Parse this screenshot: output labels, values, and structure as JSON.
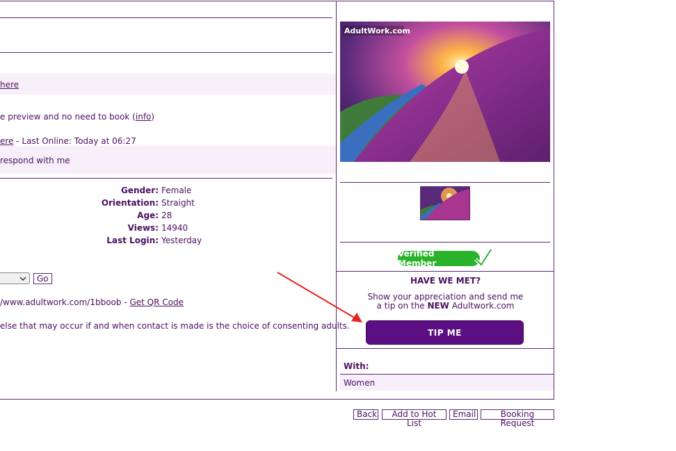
{
  "left": {
    "row_here": "here",
    "preview_text": "e preview and no need to book (",
    "info_link": "info",
    "preview_close": ")",
    "here_link2": "ere",
    "last_online": " - Last Online: Today at 06:27",
    "respond_text": "respond with me",
    "profile": [
      {
        "label": "Gender:",
        "value": "Female"
      },
      {
        "label": "Orientation:",
        "value": "Straight"
      },
      {
        "label": "Age:",
        "value": "28"
      },
      {
        "label": "Views:",
        "value": "14940"
      },
      {
        "label": "Last Login:",
        "value": "Yesterday"
      }
    ],
    "go_label": "Go",
    "url_text": "/www.adultwork.com/1bboob - ",
    "qr_link": "Get QR Code",
    "disclaimer": " else that may occur if and when contact is made is the choice of consenting adults."
  },
  "right": {
    "watermark": "AdultWork.com",
    "verified_label": "Verified Member",
    "have_we_met": "HAVE WE MET?",
    "tip_line1": "Show your appreciation and send me",
    "tip_line2_pre": "a tip on the ",
    "tip_line2_bold": "NEW",
    "tip_line2_post": " Adultwork.com",
    "tip_button": "TIP ME",
    "with_label": "With:",
    "with_value": "Women"
  },
  "bottom_buttons": {
    "back": "Back",
    "hotlist": "Add to Hot List",
    "email": "Email",
    "booking": "Booking Request"
  },
  "colors": {
    "text": "#4b1060",
    "band": "#f7effa",
    "tip_button": "#5c0f82",
    "verified": "#2ab22a",
    "arrow": "#e8231f"
  },
  "icons": [
    "checkmark-icon",
    "select-chevron-icon",
    "annotation-arrow"
  ]
}
